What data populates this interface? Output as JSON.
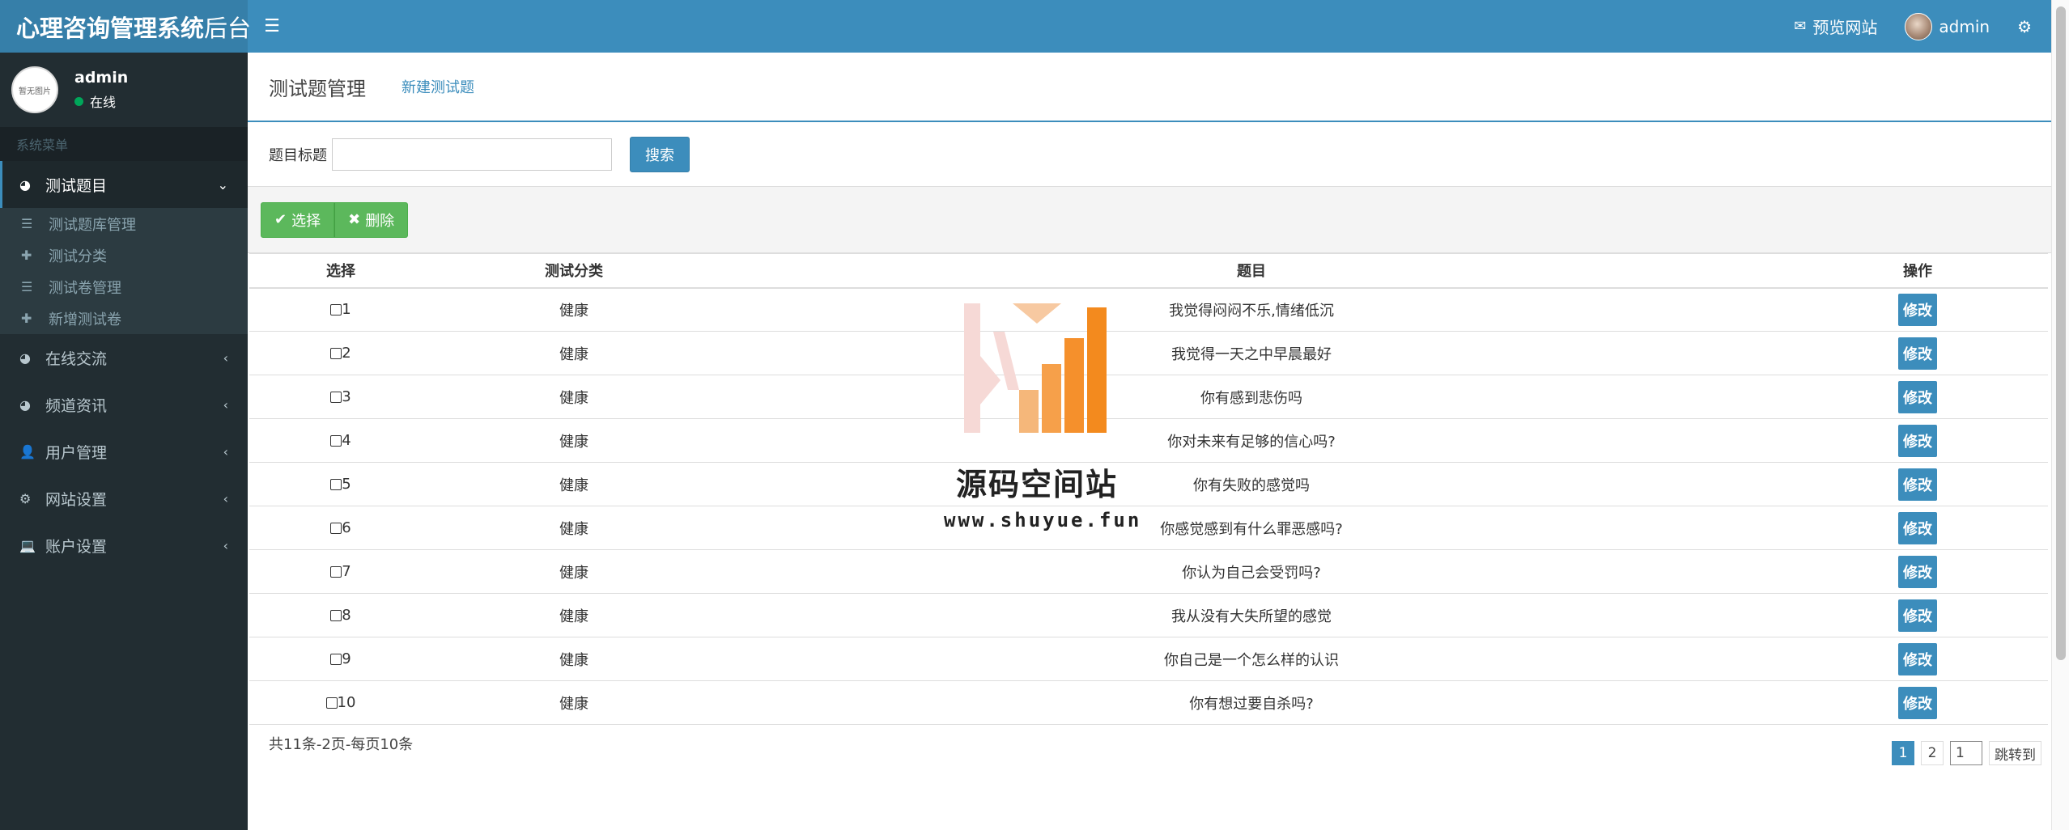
{
  "app": {
    "title_main": "心理咨询管理系统",
    "title_suffix": "后台"
  },
  "topbar": {
    "preview_site": "预览网站",
    "user": "admin"
  },
  "sidebar": {
    "avatar_text": "暂无图片",
    "username": "admin",
    "status": "在线",
    "menu_header": "系统菜单",
    "active_group": {
      "label": "测试题目",
      "children": [
        {
          "label": "测试题库管理",
          "icon": "list-icon"
        },
        {
          "label": "测试分类",
          "icon": "plus-icon"
        },
        {
          "label": "测试卷管理",
          "icon": "list-icon"
        },
        {
          "label": "新增测试卷",
          "icon": "plus-icon"
        }
      ]
    },
    "items": [
      {
        "label": "在线交流",
        "icon": "pie-chart-icon"
      },
      {
        "label": "频道资讯",
        "icon": "pie-chart-icon"
      },
      {
        "label": "用户管理",
        "icon": "user-icon"
      },
      {
        "label": "网站设置",
        "icon": "gear-icon"
      },
      {
        "label": "账户设置",
        "icon": "laptop-icon"
      }
    ]
  },
  "page": {
    "tab_title": "测试题管理",
    "tab_new": "新建测试题",
    "search": {
      "label": "题目标题",
      "value": "",
      "button": "搜索"
    },
    "toolbar": {
      "select": "选择",
      "delete": "删除"
    },
    "table": {
      "headers": [
        "选择",
        "测试分类",
        "题目",
        "操作"
      ],
      "edit_label": "修改",
      "rows": [
        {
          "id": "1",
          "category": "健康",
          "title": "我觉得闷闷不乐,情绪低沉"
        },
        {
          "id": "2",
          "category": "健康",
          "title": "我觉得一天之中早晨最好"
        },
        {
          "id": "3",
          "category": "健康",
          "title": "你有感到悲伤吗"
        },
        {
          "id": "4",
          "category": "健康",
          "title": "你对未来有足够的信心吗?"
        },
        {
          "id": "5",
          "category": "健康",
          "title": "你有失败的感觉吗"
        },
        {
          "id": "6",
          "category": "健康",
          "title": "你感觉感到有什么罪恶感吗?"
        },
        {
          "id": "7",
          "category": "健康",
          "title": "你认为自己会受罚吗?"
        },
        {
          "id": "8",
          "category": "健康",
          "title": "我从没有大失所望的感觉"
        },
        {
          "id": "9",
          "category": "健康",
          "title": "你自己是一个怎么样的认识"
        },
        {
          "id": "10",
          "category": "健康",
          "title": "你有想过要自杀吗?"
        }
      ]
    },
    "footer": {
      "summary": "共11条-2页-每页10条",
      "pages": [
        "1",
        "2"
      ],
      "page_input": "1",
      "jump": "跳转到"
    }
  },
  "watermark": {
    "title": "源码空间站",
    "url": "www.shuyue.fun"
  },
  "colors": {
    "primary": "#3c8dbc",
    "sidebar": "#222d32",
    "success": "#5cb85c",
    "online": "#00a65a"
  }
}
